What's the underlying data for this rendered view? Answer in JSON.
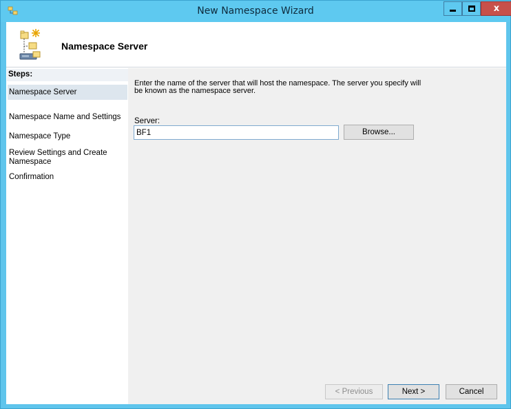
{
  "window": {
    "title": "New Namespace Wizard",
    "close_glyph": "x"
  },
  "header": {
    "title": "Namespace Server"
  },
  "steps": {
    "heading": "Steps:",
    "items": [
      {
        "label": "Namespace Server"
      },
      {
        "label": "Namespace Name and Settings"
      },
      {
        "label": "Namespace Type"
      },
      {
        "label": "Review Settings and Create Namespace"
      },
      {
        "label": "Confirmation"
      }
    ]
  },
  "content": {
    "description": "Enter the name of the server that will host the namespace. The server you specify will be known as the namespace server.",
    "server_label": "Server:",
    "server_value": "BF1",
    "browse_label": "Browse..."
  },
  "footer": {
    "previous_label": "< Previous",
    "next_label": "Next >",
    "cancel_label": "Cancel"
  },
  "colors": {
    "titlebar": "#5ec9f0",
    "close_button": "#c7504a",
    "active_step": "#dde6ee"
  },
  "icons": {
    "app": "namespace-app-icon",
    "header": "namespace-server-icon",
    "minimize": "minimize-icon",
    "maximize": "maximize-icon",
    "close": "close-icon"
  }
}
